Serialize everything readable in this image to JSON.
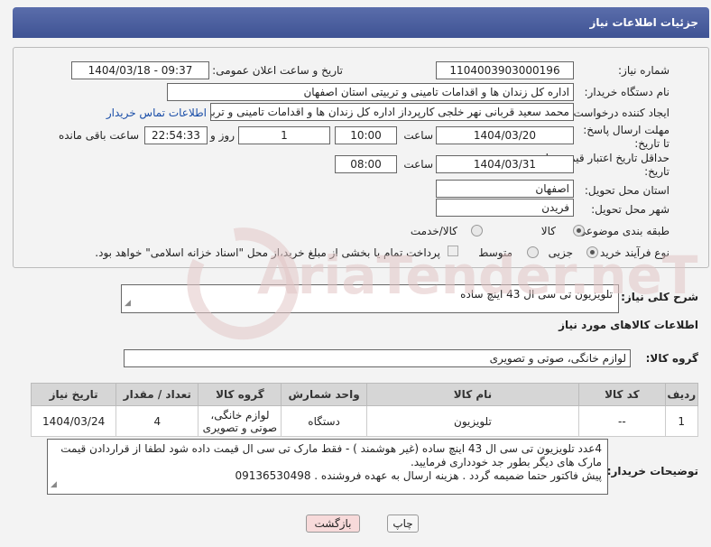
{
  "header": {
    "title": "جزئیات اطلاعات نیاز"
  },
  "form": {
    "need_number_label": "شماره نیاز:",
    "need_number": "1104003903000196",
    "announce_label": "تاریخ و ساعت اعلان عمومی:",
    "announce_value": "1404/03/18 - 09:37",
    "buyer_org_label": "نام دستگاه خریدار:",
    "buyer_org": "اداره کل زندان ها و اقدامات تامینی و تربیتی استان اصفهان",
    "creator_label": "ایجاد کننده درخواست:",
    "creator": "محمد سعید قربانی نهر خلجی کارپرداز اداره کل زندان ها و اقدامات تامینی و تربیتی",
    "contact_link": "اطلاعات تماس خریدار",
    "deadline_label": "مهلت ارسال پاسخ: تا تاریخ:",
    "deadline_date": "1404/03/20",
    "time_label": "ساعت",
    "deadline_time": "10:00",
    "days_count": "1",
    "days_label": "روز و",
    "remaining_time": "22:54:33",
    "remaining_label": "ساعت باقی مانده",
    "validity_label": "حداقل تاریخ اعتبار قیمت: تا تاریخ:",
    "validity_date": "1404/03/31",
    "validity_time": "08:00",
    "province_label": "استان محل تحویل:",
    "province": "اصفهان",
    "city_label": "شهر محل تحویل:",
    "city": "فریدن",
    "category_label": "طبقه بندی موضوعی:",
    "category_goods": "کالا",
    "category_goods_service": "کالا/خدمت",
    "process_label": "نوع فرآیند خرید :",
    "process_partial": "جزیی",
    "process_medium": "متوسط",
    "process_note": "پرداخت تمام یا بخشی از مبلغ خرید،از محل \"اسناد خزانه اسلامی\" خواهد بود."
  },
  "summary": {
    "label": "شرح کلی نیاز:",
    "value": "تلویزیون تی سی ال 43 اینچ ساده"
  },
  "goods_section": {
    "title": "اطلاعات کالاهای مورد نیاز",
    "group_label": "گروه کالا:",
    "group_value": "لوازم خانگی، صوتی و تصویری"
  },
  "table": {
    "headers": [
      "ردیف",
      "کد کالا",
      "نام کالا",
      "واحد شمارش",
      "گروه کالا",
      "تعداد / مقدار",
      "تاریخ نیاز"
    ],
    "rows": [
      [
        "1",
        "--",
        "تلویزیون",
        "دستگاه",
        "لوازم خانگی، صوتی و تصویری",
        "4",
        "1404/03/24"
      ]
    ]
  },
  "buyer_notes": {
    "label": "توضیحات خریدار:",
    "line1": "4عدد تلویزیون تی سی ال 43 اینچ ساده (غیر هوشمند ) - فقط مارک تی سی ال قیمت داده شود لطفا از قراردادن قیمت",
    "line2": "مارک های دیگر بطور جد خودداری فرمایید.",
    "line3": "پیش فاکتور حتما ضمیمه گردد . هزینه ارسال به عهده فروشنده . 09136530498"
  },
  "buttons": {
    "print": "چاپ",
    "back": "بازگشت"
  },
  "watermark": {
    "text": "AriaTender.neT"
  },
  "colors": {
    "header_bg": "#4a5e9f",
    "link": "#1a4ea8",
    "back_bg": "#f7dada",
    "watermark": "#e3c9c9"
  }
}
